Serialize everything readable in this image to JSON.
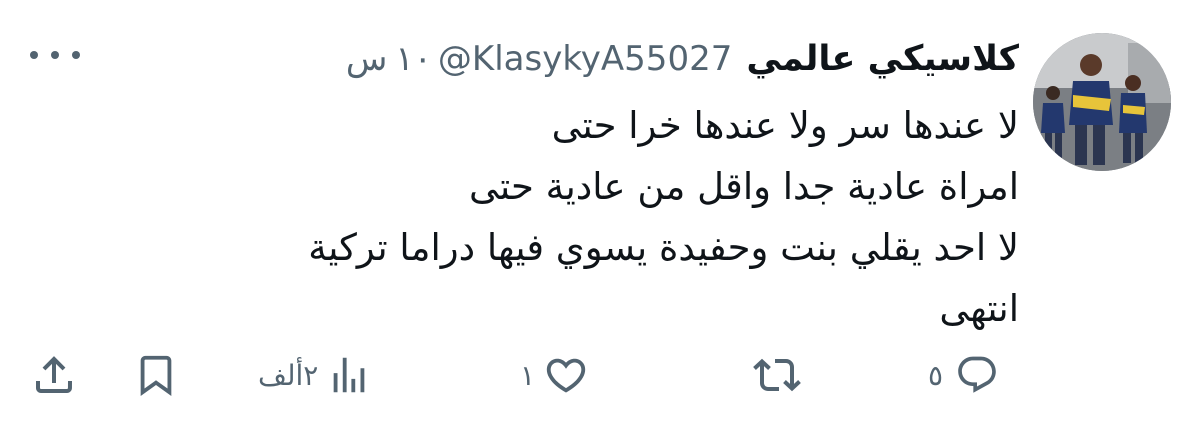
{
  "tweet": {
    "display_name": "كلاسيكي عالمي",
    "handle": "@KlasykyA55027",
    "time_value": "١٠",
    "time_unit": "س",
    "text_lines": [
      "لا عندها سر ولا عندها خرا حتى",
      "امراة عادية جدا واقل من عادية حتى",
      "لا احد يقلي بنت وحفيدة يسوي فيها دراما تركية",
      "انتهى"
    ]
  },
  "actions": {
    "reply_count": "٥",
    "retweet_count": "",
    "like_count": "١",
    "views_count": "٢ألف"
  },
  "icons": {
    "more": "more-horizontal-icon",
    "reply": "reply-icon",
    "retweet": "retweet-icon",
    "like": "heart-icon",
    "views": "views-chart-icon",
    "bookmark": "bookmark-icon",
    "share": "share-icon"
  },
  "colors": {
    "text_primary": "#0f1419",
    "text_secondary": "#536471",
    "background": "#ffffff"
  }
}
